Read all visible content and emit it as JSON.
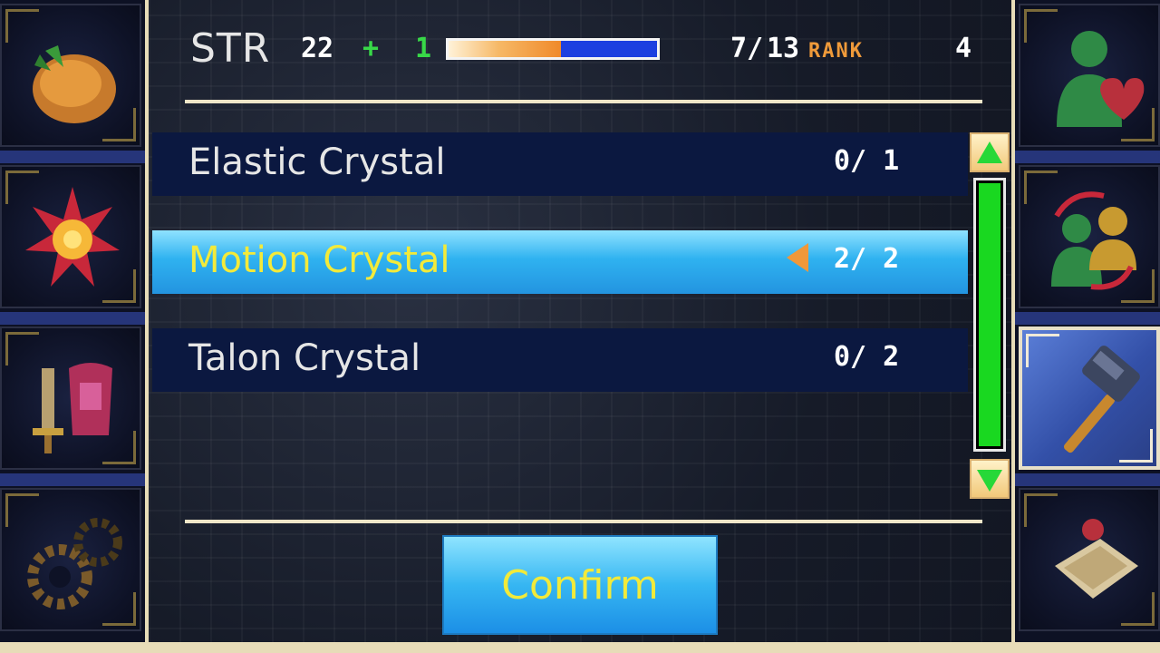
{
  "stat": {
    "label": "STR",
    "base": "22",
    "plus": "+",
    "bonus": "1",
    "exp_current": "7",
    "exp_sep": "/",
    "exp_max": "13",
    "exp_fraction": 0.5385,
    "rank_label": "RANK",
    "rank_value": "4"
  },
  "crystals": [
    {
      "name": "Elastic Crystal",
      "count": "0/ 1",
      "selected": false
    },
    {
      "name": "Motion Crystal",
      "count": "2/ 2",
      "selected": true
    },
    {
      "name": "Talon Crystal",
      "count": "0/ 2",
      "selected": false
    }
  ],
  "confirm_label": "Confirm",
  "left_icons": [
    "money-bag-icon",
    "burst-icon",
    "sword-armor-icon",
    "gear-icon"
  ],
  "right_icons": [
    "heart-person-icon",
    "swap-party-icon",
    "hammer-icon",
    "scroll-map-icon"
  ],
  "colors": {
    "accent_yellow": "#f3ea3a",
    "selection_blue": "#2fb2f0",
    "scroll_green": "#19d820",
    "rank_orange": "#ef9a3a"
  }
}
